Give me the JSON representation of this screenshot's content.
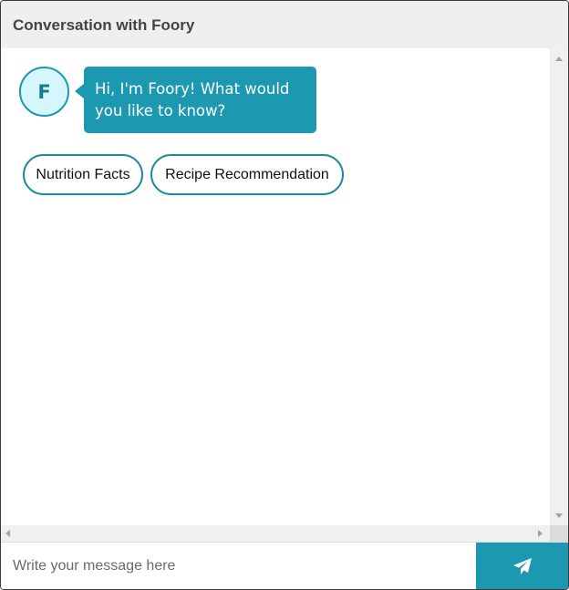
{
  "window": {
    "title": "Conversation with Foory"
  },
  "conversation": {
    "avatar_initial": "F",
    "bot_message": "Hi, I'm Foory! What would you like to know?"
  },
  "quick_replies": [
    {
      "label": "Nutrition Facts"
    },
    {
      "label": "Recipe Recommendation"
    }
  ],
  "composer": {
    "placeholder": "Write your message here",
    "value": "",
    "send_icon": "paper-plane-icon"
  },
  "colors": {
    "accent": "#1c98b0",
    "avatar_bg": "#d6f6fd",
    "header_bg": "#efefef"
  }
}
